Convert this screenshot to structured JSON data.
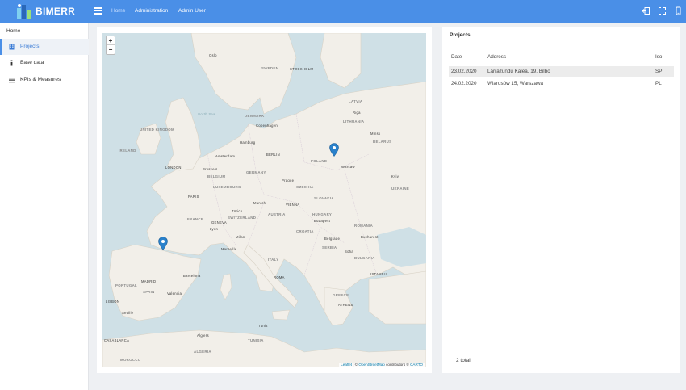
{
  "app": {
    "logo_text": "BIMERR",
    "accent": "#4a8fe7"
  },
  "header": {
    "nav": [
      "Home",
      "Administration",
      "Admin User"
    ],
    "icons": [
      "logout-icon",
      "fullscreen-icon",
      "mobile-icon"
    ]
  },
  "sidebar": {
    "breadcrumb": "Home",
    "items": [
      {
        "label": "Projects",
        "icon": "building-icon",
        "active": true
      },
      {
        "label": "Base data",
        "icon": "info-icon",
        "active": false
      },
      {
        "label": "KPIs & Measures",
        "icon": "list-icon",
        "active": false
      }
    ]
  },
  "map": {
    "zoom_in": "+",
    "zoom_out": "−",
    "attribution": {
      "leaflet": "Leaflet",
      "sep": " | © ",
      "osm": "OpenStreetMap",
      "contrib": " contributors © ",
      "carto": "CARTO"
    },
    "labels": {
      "sweden": "SWEDEN",
      "stockholm": "STOCKHOLM",
      "oslo": "Oslo",
      "latvia": "LATVIA",
      "lithuania": "LITHUANIA",
      "belarus": "BELARUS",
      "ukraine": "UKRAINE",
      "poland": "POLAND",
      "germany": "GERMANY",
      "berlin": "BERLIN",
      "hamburg": "Hamburg",
      "belgium": "BELGIUM",
      "luxembourg": "LUXEMBOURG",
      "france": "FRANCE",
      "paris": "PARIS",
      "switzerland": "SWITZERLAND",
      "austria": "AUSTRIA",
      "vienna": "VIENNA",
      "czechia": "CZECHIA",
      "slovakia": "SLOVAKIA",
      "hungary": "HUNGARY",
      "romania": "ROMANIA",
      "serbia": "SERBIA",
      "bulgaria": "BULGARIA",
      "italy": "ITALY",
      "greece": "GREECE",
      "athens": "ATHENS",
      "spain": "SPAIN",
      "madrid": "MADRID",
      "portugal": "PORTUGAL",
      "morocco": "MOROCCO",
      "algeria": "ALGERIA",
      "tunisia": "TUNISIA",
      "uk": "UNITED KINGDOM",
      "london": "LONDON",
      "ireland": "IRELAND",
      "denmark": "DENMARK",
      "north_sea": "North Sea",
      "croatia": "CROATIA",
      "istanbul": "ISTANBUL",
      "warsaw": "Warsaw",
      "munich": "Munich",
      "geneva": "GENEVA",
      "lyon": "Lyon",
      "marseille": "Marseille",
      "casablanca": "CASABLANCA",
      "rome": "ROMA",
      "belgrade": "Belgrade",
      "sofia": "Sofia",
      "bucharest": "Bucharest",
      "riga": "Riga",
      "minsk": "Minsk",
      "kyiv": "Kyiv",
      "budapest": "Budapest",
      "prague": "Prague",
      "milan": "Milan",
      "barcelona": "Barcelona",
      "valencia": "Valencia",
      "lisbon": "LISBON",
      "seville": "Seville",
      "tunis": "Tunis",
      "algiers": "Algiers",
      "copenhagen": "Copenhagen",
      "amsterdam": "Amsterdam",
      "brussels": "Brussels",
      "zurich": "Zürich"
    },
    "markers": [
      {
        "name": "marker-bilbao",
        "color": "#2a81cb"
      },
      {
        "name": "marker-warsaw",
        "color": "#2a81cb"
      }
    ]
  },
  "projects": {
    "title": "Projects",
    "columns": [
      "Date",
      "Address",
      "Iso"
    ],
    "rows": [
      {
        "date": "23.02.2020",
        "address": "Larrazundu Kalea, 19, Bilbo",
        "iso": "SP"
      },
      {
        "date": "24.02.2020",
        "address": "Wiarusów 15, Warszawa",
        "iso": "PL"
      }
    ],
    "total": "2 total"
  }
}
